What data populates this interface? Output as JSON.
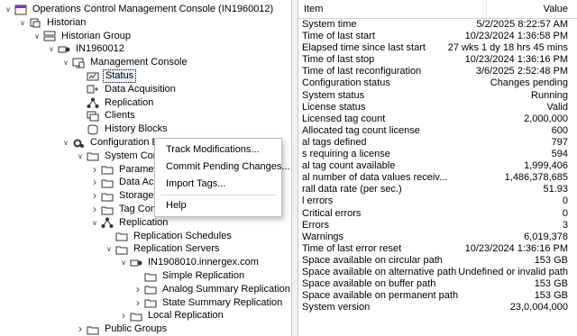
{
  "tree": [
    {
      "label": "Operations Control Management Console (IN1960012)",
      "indent": 0,
      "chev": "v",
      "icon": "console-root-icon"
    },
    {
      "label": "Historian",
      "indent": 1,
      "chev": "v",
      "icon": "historian-icon"
    },
    {
      "label": "Historian Group",
      "indent": 2,
      "chev": "v",
      "icon": "group-icon"
    },
    {
      "label": "IN1960012",
      "indent": 3,
      "chev": "v",
      "icon": "server-icon"
    },
    {
      "label": "Management Console",
      "indent": 4,
      "chev": "v",
      "icon": "monitor-icon"
    },
    {
      "label": "Status",
      "indent": 5,
      "chev": "",
      "icon": "status-icon",
      "selected": true
    },
    {
      "label": "Data Acquisition",
      "indent": 5,
      "chev": "",
      "icon": "acquisition-icon"
    },
    {
      "label": "Replication",
      "indent": 5,
      "chev": "",
      "icon": "replication-icon"
    },
    {
      "label": "Clients",
      "indent": 5,
      "chev": "",
      "icon": "clients-icon"
    },
    {
      "label": "History Blocks",
      "indent": 5,
      "chev": "",
      "icon": "database-icon"
    },
    {
      "label": "Configuration E",
      "indent": 4,
      "chev": "v",
      "icon": "configuration-icon"
    },
    {
      "label": "System Con",
      "indent": 5,
      "chev": "v",
      "icon": "folder-icon"
    },
    {
      "label": "Paramet",
      "indent": 6,
      "chev": ">",
      "icon": "folder-icon"
    },
    {
      "label": "Data Ac",
      "indent": 6,
      "chev": ">",
      "icon": "folder-icon"
    },
    {
      "label": "Storage",
      "indent": 6,
      "chev": ">",
      "icon": "folder-icon"
    },
    {
      "label": "Tag Configuration",
      "indent": 6,
      "chev": ">",
      "icon": "folder-icon"
    },
    {
      "label": "Replication",
      "indent": 6,
      "chev": "v",
      "icon": "replication-icon"
    },
    {
      "label": "Replication Schedules",
      "indent": 7,
      "chev": "",
      "icon": "folder-icon"
    },
    {
      "label": "Replication Servers",
      "indent": 7,
      "chev": "v",
      "icon": "folder-icon"
    },
    {
      "label": "IN1908010.innergex.com",
      "indent": 8,
      "chev": "v",
      "icon": "server-icon"
    },
    {
      "label": "Simple Replication",
      "indent": 9,
      "chev": "",
      "icon": "folder-icon"
    },
    {
      "label": "Analog Summary Replication",
      "indent": 9,
      "chev": ">",
      "icon": "folder-icon"
    },
    {
      "label": "State Summary Replication",
      "indent": 9,
      "chev": ">",
      "icon": "folder-icon"
    },
    {
      "label": "Local Replication",
      "indent": 8,
      "chev": ">",
      "icon": "folder-icon"
    },
    {
      "label": "Public Groups",
      "indent": 5,
      "chev": ">",
      "icon": "folder-icon"
    }
  ],
  "table": {
    "col_item": "Item",
    "col_value": "Value",
    "rows": [
      {
        "k": "System time",
        "v": "5/2/2025 8:22:57 AM"
      },
      {
        "k": "Time of last start",
        "v": "10/23/2024 1:36:58 PM"
      },
      {
        "k": "Elapsed time since last start",
        "v": "27 wks 1 dy 18 hrs 45 mins"
      },
      {
        "k": "Time of last stop",
        "v": "10/23/2024 1:36:16 PM"
      },
      {
        "k": "Time of last reconfiguration",
        "v": "3/6/2025 2:52:48 PM"
      },
      {
        "k": "Configuration status",
        "v": "Changes pending"
      },
      {
        "k": "System status",
        "v": "Running"
      },
      {
        "k": "License status",
        "v": "Valid"
      },
      {
        "k": "Licensed tag count",
        "v": "2,000,000"
      },
      {
        "k": "Allocated tag count license",
        "v": "600"
      },
      {
        "k": "al tags defined",
        "v": "797"
      },
      {
        "k": "s requiring a license",
        "v": "594"
      },
      {
        "k": "al tag count available",
        "v": "1,999,406"
      },
      {
        "k": "al number of data values receiv...",
        "v": "1,486,378,685"
      },
      {
        "k": "rall data rate (per sec.)",
        "v": "51.93"
      },
      {
        "k": "l errors",
        "v": "0"
      },
      {
        "k": "Critical errors",
        "v": "0"
      },
      {
        "k": "Errors",
        "v": "3"
      },
      {
        "k": "Warnings",
        "v": "6,019,378"
      },
      {
        "k": "Time of last error reset",
        "v": "10/23/2024 1:36:16 PM"
      },
      {
        "k": "Space available on circular path",
        "v": "153 GB"
      },
      {
        "k": "Space available on alternative path",
        "v": "Undefined or invalid path"
      },
      {
        "k": "Space available on buffer path",
        "v": "153 GB"
      },
      {
        "k": "Space available on permanent path",
        "v": "153 GB"
      },
      {
        "k": "System version",
        "v": "23,0,004,000"
      }
    ]
  },
  "context_menu": {
    "items": [
      {
        "label": "Track Modifications..."
      },
      {
        "label": "Commit Pending Changes..."
      },
      {
        "label": "Import Tags..."
      },
      {
        "label": "Help"
      }
    ]
  }
}
